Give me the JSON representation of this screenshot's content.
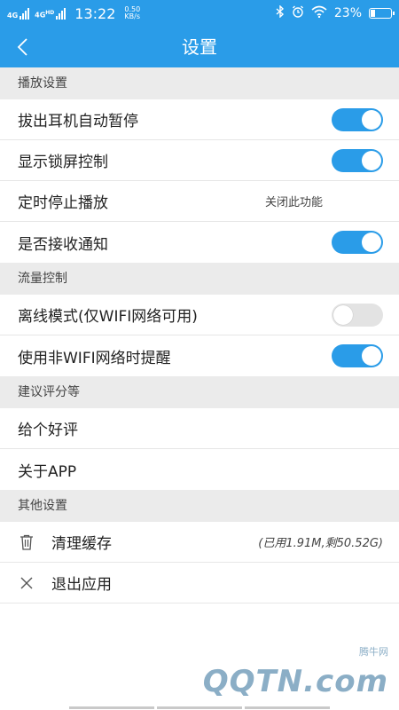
{
  "status_bar": {
    "signal1": "4G",
    "signal2": "4G",
    "signal2_sup": "HD",
    "time": "13:22",
    "speed_value": "0.50",
    "speed_unit": "KB/s",
    "battery": "23%",
    "battery_level_percent": 23,
    "icons": [
      "bluetooth-icon",
      "alarm-icon",
      "wifi-icon",
      "battery-icon"
    ]
  },
  "header": {
    "title": "设置",
    "back_icon": "chevron-left-icon"
  },
  "sections": [
    {
      "title": "播放设置",
      "items": [
        {
          "label": "拔出耳机自动暂停",
          "control": "toggle",
          "on": true
        },
        {
          "label": "显示锁屏控制",
          "control": "toggle",
          "on": true
        },
        {
          "label": "定时停止播放",
          "control": "value",
          "value": "关闭此功能"
        },
        {
          "label": "是否接收通知",
          "control": "toggle",
          "on": true
        }
      ]
    },
    {
      "title": "流量控制",
      "items": [
        {
          "label": "离线模式(仅WIFI网络可用)",
          "control": "toggle",
          "on": false
        },
        {
          "label": "使用非WIFI网络时提醒",
          "control": "toggle",
          "on": true
        }
      ]
    },
    {
      "title": "建议评分等",
      "items": [
        {
          "label": "给个好评"
        },
        {
          "label": "关于APP"
        }
      ]
    },
    {
      "title": "其他设置",
      "items": [
        {
          "label": "清理缓存",
          "icon": "trash-icon",
          "value": "(已用1.91M,剩50.52G)"
        },
        {
          "label": "退出应用",
          "icon": "close-icon"
        }
      ]
    }
  ],
  "watermark": {
    "small": "腾牛网",
    "big": "QQTN.com"
  },
  "colors": {
    "accent": "#2a9ce8",
    "section_bg": "#ebebeb",
    "toggle_off": "#e3e3e3"
  }
}
